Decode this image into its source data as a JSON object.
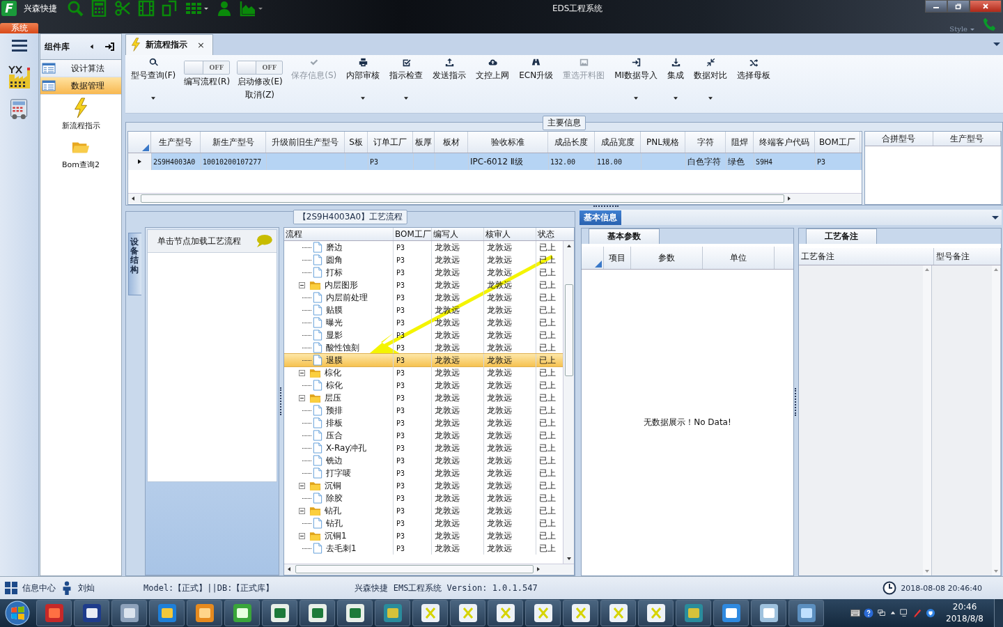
{
  "window": {
    "title": "EDS工程系统",
    "app_logo": "F",
    "app_name": "兴森快捷"
  },
  "system_menu": {
    "label": "系统",
    "selected": true
  },
  "style_menu": "Style",
  "component_library": {
    "title": "组件库",
    "categories": [
      {
        "label": "设计算法",
        "selected": false
      },
      {
        "label": "数据管理",
        "selected": true
      }
    ],
    "components": [
      {
        "label": "新流程指示",
        "kind": "lightning"
      },
      {
        "label": "Bom查询2",
        "kind": "folder"
      }
    ]
  },
  "document_tab": {
    "label": "新流程指示",
    "close": "×",
    "selected": true
  },
  "ribbon": [
    {
      "kind": "button",
      "label": "型号查询(F)",
      "disabled": false,
      "dropdown": true
    },
    {
      "kind": "toggle",
      "state_text": "OFF",
      "on": false,
      "label": "编写流程(R)"
    },
    {
      "kind": "toggle",
      "state_text": "OFF",
      "on": false,
      "label": "启动修改(E)",
      "label_line2": "取消(Z)"
    },
    {
      "kind": "button",
      "label": "保存信息(S)",
      "disabled": true,
      "dropdown": false
    },
    {
      "kind": "button",
      "label": "内部审核",
      "disabled": false,
      "dropdown": true
    },
    {
      "kind": "button",
      "label": "指示检查",
      "disabled": false,
      "dropdown": true
    },
    {
      "kind": "button",
      "label": "发送指示",
      "disabled": false,
      "dropdown": false
    },
    {
      "kind": "button",
      "label": "文控上网",
      "disabled": false,
      "dropdown": false
    },
    {
      "kind": "button",
      "label": "ECN升级",
      "disabled": false,
      "dropdown": false
    },
    {
      "kind": "button",
      "label": "重选开料图",
      "disabled": true,
      "dropdown": false
    },
    {
      "kind": "button",
      "label": "MI数据导入",
      "disabled": false,
      "dropdown": true
    },
    {
      "kind": "button",
      "label": "集成",
      "disabled": false,
      "dropdown": true
    },
    {
      "kind": "button",
      "label": "数据对比",
      "disabled": false,
      "dropdown": true
    },
    {
      "kind": "button",
      "label": "选择母板",
      "disabled": false,
      "dropdown": false
    }
  ],
  "main_info": {
    "title": "主要信息",
    "columns": [
      "生产型号",
      "新生产型号",
      "升级前旧生产型号",
      "S板",
      "订单工厂",
      "板厚",
      "板材",
      "验收标准",
      "成品长度",
      "成品宽度",
      "PNL规格",
      "字符",
      "阻焊",
      "终端客户代码",
      "BOM工厂"
    ],
    "rows": [
      {
        "selected": true,
        "cells": [
          "2S9H4003A0",
          "10010200107277",
          null,
          null,
          "P3",
          null,
          null,
          "IPC-6012 Ⅱ级",
          "132.00",
          "118.00",
          null,
          "白色字符",
          "绿色",
          "S9H4",
          "P3"
        ]
      }
    ],
    "side_columns": [
      "合拼型号",
      "生产型号"
    ]
  },
  "process": {
    "title": "【2S9H4003A0】工艺流程",
    "side_tab": "设备结构",
    "hint": "单击节点加载工艺流程",
    "columns": [
      "流程",
      "BOM工厂",
      "编写人",
      "核审人",
      "状态"
    ],
    "continued_items": [
      {
        "label": "磨边",
        "factory": "P3",
        "writer": "龙敦远",
        "reviewer": "龙敦远",
        "status": "已上",
        "selected": false
      },
      {
        "label": "圆角",
        "factory": "P3",
        "writer": "龙敦远",
        "reviewer": "龙敦远",
        "status": "已上",
        "selected": false
      },
      {
        "label": "打标",
        "factory": "P3",
        "writer": "龙敦远",
        "reviewer": "龙敦远",
        "status": "已上",
        "selected": false
      }
    ],
    "folders": [
      {
        "label": "内层图形",
        "factory": "P3",
        "writer": "龙敦远",
        "reviewer": "龙敦远",
        "status": "已上",
        "selected": false,
        "expanded": true,
        "children": [
          {
            "label": "内层前处理",
            "factory": "P3",
            "writer": "龙敦远",
            "reviewer": "龙敦远",
            "status": "已上",
            "selected": false
          },
          {
            "label": "贴膜",
            "factory": "P3",
            "writer": "龙敦远",
            "reviewer": "龙敦远",
            "status": "已上",
            "selected": false
          },
          {
            "label": "曝光",
            "factory": "P3",
            "writer": "龙敦远",
            "reviewer": "龙敦远",
            "status": "已上",
            "selected": false
          },
          {
            "label": "显影",
            "factory": "P3",
            "writer": "龙敦远",
            "reviewer": "龙敦远",
            "status": "已上",
            "selected": false
          },
          {
            "label": "酸性蚀刻",
            "factory": "P3",
            "writer": "龙敦远",
            "reviewer": "龙敦远",
            "status": "已上",
            "selected": false
          },
          {
            "label": "退膜",
            "factory": "P3",
            "writer": "龙敦远",
            "reviewer": "龙敦远",
            "status": "已上",
            "selected": true
          }
        ]
      },
      {
        "label": "棕化",
        "factory": "P3",
        "writer": "龙敦远",
        "reviewer": "龙敦远",
        "status": "已上",
        "selected": false,
        "expanded": true,
        "children": [
          {
            "label": "棕化",
            "factory": "P3",
            "writer": "龙敦远",
            "reviewer": "龙敦远",
            "status": "已上",
            "selected": false
          }
        ]
      },
      {
        "label": "层压",
        "factory": "P3",
        "writer": "龙敦远",
        "reviewer": "龙敦远",
        "status": "已上",
        "selected": false,
        "expanded": true,
        "children": [
          {
            "label": "预排",
            "factory": "P3",
            "writer": "龙敦远",
            "reviewer": "龙敦远",
            "status": "已上",
            "selected": false
          },
          {
            "label": "排板",
            "factory": "P3",
            "writer": "龙敦远",
            "reviewer": "龙敦远",
            "status": "已上",
            "selected": false
          },
          {
            "label": "压合",
            "factory": "P3",
            "writer": "龙敦远",
            "reviewer": "龙敦远",
            "status": "已上",
            "selected": false
          },
          {
            "label": "X-Ray冲孔",
            "factory": "P3",
            "writer": "龙敦远",
            "reviewer": "龙敦远",
            "status": "已上",
            "selected": false
          },
          {
            "label": "铣边",
            "factory": "P3",
            "writer": "龙敦远",
            "reviewer": "龙敦远",
            "status": "已上",
            "selected": false
          },
          {
            "label": "打字唛",
            "factory": "P3",
            "writer": "龙敦远",
            "reviewer": "龙敦远",
            "status": "已上",
            "selected": false
          }
        ]
      },
      {
        "label": "沉铜",
        "factory": "P3",
        "writer": "龙敦远",
        "reviewer": "龙敦远",
        "status": "已上",
        "selected": false,
        "expanded": true,
        "children": [
          {
            "label": "除胶",
            "factory": "P3",
            "writer": "龙敦远",
            "reviewer": "龙敦远",
            "status": "已上",
            "selected": false
          }
        ]
      },
      {
        "label": "钻孔",
        "factory": "P3",
        "writer": "龙敦远",
        "reviewer": "龙敦远",
        "status": "已上",
        "selected": false,
        "expanded": true,
        "children": [
          {
            "label": "钻孔",
            "factory": "P3",
            "writer": "龙敦远",
            "reviewer": "龙敦远",
            "status": "已上",
            "selected": false
          }
        ]
      },
      {
        "label": "沉铜1",
        "factory": "P3",
        "writer": "龙敦远",
        "reviewer": "龙敦远",
        "status": "已上",
        "selected": false,
        "expanded": true,
        "children": [
          {
            "label": "去毛刺1",
            "factory": "P3",
            "writer": "龙敦远",
            "reviewer": "龙敦远",
            "status": "已上",
            "selected": false
          }
        ]
      }
    ]
  },
  "basic_info": {
    "title": "基本信息",
    "params_tab": "基本参数",
    "param_columns": [
      "项目",
      "参数",
      "单位"
    ],
    "empty_message": "无数据展示！No Data!",
    "notes_tab": "工艺备注",
    "notes_columns": [
      "工艺备注",
      "型号备注"
    ]
  },
  "status_bar": {
    "info_center": "信息中心",
    "user": "刘灿",
    "model_db": "Model:【正式】||DB:【正式库】",
    "version": "兴森快捷 EMS工程系统 Version: 1.0.1.547",
    "datetime": "2018-08-08 20:46:40"
  },
  "taskbar": {
    "time": "20:46",
    "date": "2018/8/8"
  }
}
